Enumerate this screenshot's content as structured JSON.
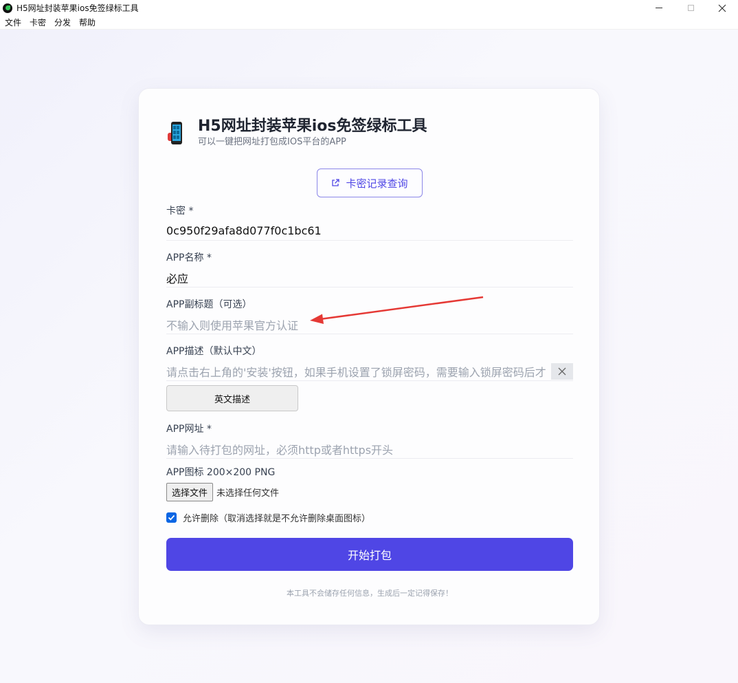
{
  "window": {
    "title": "H5网址封装苹果ios免签绿标工具",
    "minimize": "—",
    "maximize": "☐",
    "close": "✕"
  },
  "menu": [
    "文件",
    "卡密",
    "分发",
    "帮助"
  ],
  "header": {
    "title": "H5网址封装苹果ios免签绿标工具",
    "subtitle": "可以一键把网址打包成IOS平台的APP"
  },
  "query_button": "卡密记录查询",
  "fields": {
    "card_key": {
      "label": "卡密 *",
      "value": "0c950f29afa8d077f0c1bc61"
    },
    "app_name": {
      "label": "APP名称 *",
      "value": "必应"
    },
    "app_subtitle": {
      "label": "APP副标题（可选）",
      "placeholder": "不输入则使用苹果官方认证"
    },
    "app_desc": {
      "label": "APP描述（默认中文）",
      "placeholder": "请点击右上角的'安装'按钮，如果手机设置了锁屏密码，需要输入锁屏密码后才",
      "clear": "✕"
    },
    "app_url": {
      "label": "APP网址 *",
      "placeholder": "请输入待打包的网址，必须http或者https开头"
    },
    "app_icon": {
      "label": "APP图标 200×200 PNG",
      "button": "选择文件",
      "status": "未选择任何文件"
    }
  },
  "english_desc_button": "英文描述",
  "allow_delete": {
    "checked": true,
    "label": "允许删除（取消选择就是不允许删除桌面图标）"
  },
  "submit_button": "开始打包",
  "footer_note": "本工具不会储存任何信息，生成后一定记得保存！",
  "colors": {
    "accent": "#4f46e5",
    "checkbox": "#0b66e4",
    "annotation_arrow": "#e53935"
  }
}
